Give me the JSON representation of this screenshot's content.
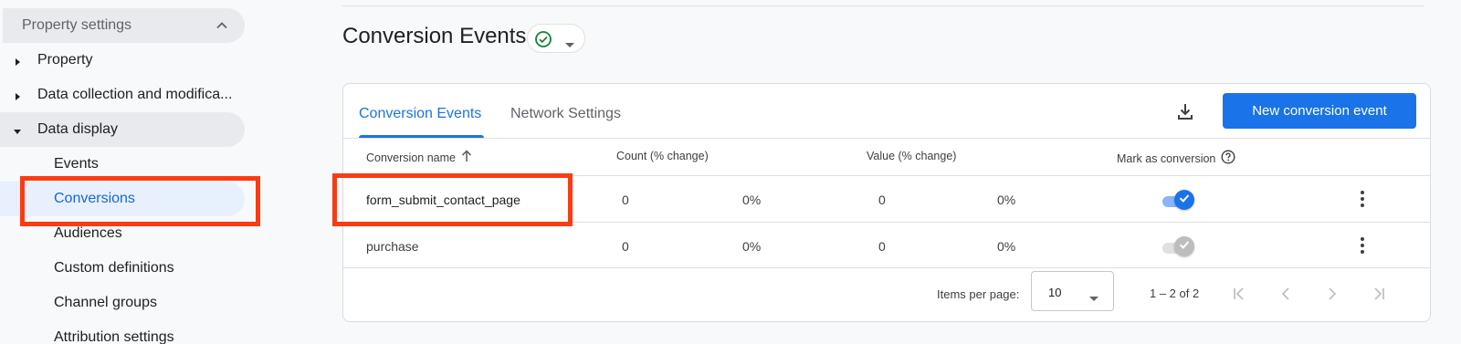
{
  "sidebar": {
    "section_title": "Property settings",
    "items": [
      {
        "label": "Property"
      },
      {
        "label": "Data collection and modifica..."
      },
      {
        "label": "Data display"
      }
    ],
    "sub_items": [
      {
        "label": "Events"
      },
      {
        "label": "Conversions"
      },
      {
        "label": "Audiences"
      },
      {
        "label": "Custom definitions"
      },
      {
        "label": "Channel groups"
      },
      {
        "label": "Attribution settings"
      }
    ]
  },
  "page": {
    "title": "Conversion Events"
  },
  "tabs": [
    {
      "label": "Conversion Events"
    },
    {
      "label": "Network Settings"
    }
  ],
  "toolbar": {
    "new_button_label": "New conversion event"
  },
  "table": {
    "headers": {
      "name": "Conversion name",
      "count": "Count (% change)",
      "value": "Value (% change)",
      "mark": "Mark as conversion"
    },
    "rows": [
      {
        "name": "form_submit_contact_page",
        "count": "0",
        "count_change": "0%",
        "value": "0",
        "value_change": "0%",
        "mark_as_conversion": true,
        "editable": true
      },
      {
        "name": "purchase",
        "count": "0",
        "count_change": "0%",
        "value": "0",
        "value_change": "0%",
        "mark_as_conversion": true,
        "editable": false
      }
    ]
  },
  "pagination": {
    "items_per_page_label": "Items per page:",
    "items_per_page_value": "10",
    "range_text": "1 – 2 of 2"
  },
  "colors": {
    "accent": "#1a73e8",
    "highlight": "#fa3b14",
    "toggle_disabled": "#9e9e9e"
  },
  "icons": [
    "chevron-up-icon",
    "caret-right-icon",
    "caret-down-icon",
    "check-circle-icon",
    "dropdown-arrow-icon",
    "download-icon",
    "arrow-up-icon",
    "help-icon",
    "check-icon",
    "more-vert-icon",
    "first-page-icon",
    "prev-page-icon",
    "next-page-icon",
    "last-page-icon"
  ]
}
